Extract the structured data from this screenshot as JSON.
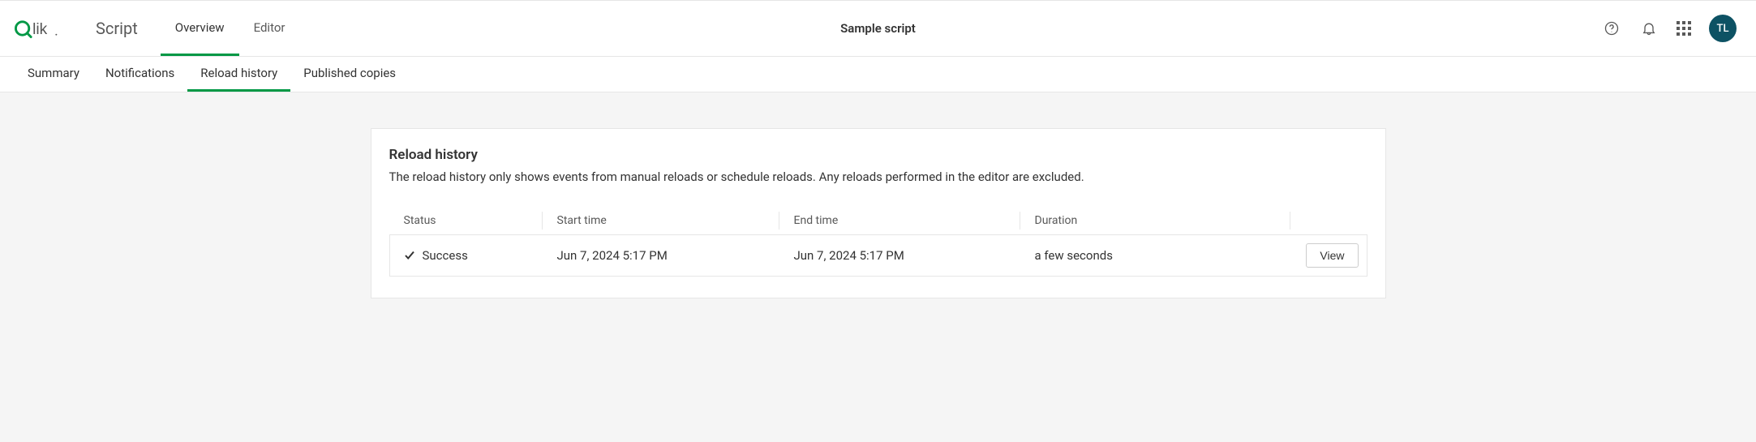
{
  "brand": {
    "name": "Qlik",
    "accent_green": "#009845",
    "accent_teal": "#0d5264"
  },
  "app_name": "Script",
  "top_tabs": [
    {
      "label": "Overview",
      "active": true
    },
    {
      "label": "Editor",
      "active": false
    }
  ],
  "page_title": "Sample script",
  "user_initials": "TL",
  "sub_tabs": [
    {
      "label": "Summary",
      "active": false
    },
    {
      "label": "Notifications",
      "active": false
    },
    {
      "label": "Reload history",
      "active": true
    },
    {
      "label": "Published copies",
      "active": false
    }
  ],
  "panel": {
    "title": "Reload history",
    "description": "The reload history only shows events from manual reloads or schedule reloads. Any reloads performed in the editor are excluded."
  },
  "table": {
    "columns": {
      "status": "Status",
      "start": "Start time",
      "end": "End time",
      "duration": "Duration"
    },
    "rows": [
      {
        "status": "Success",
        "start": "Jun 7, 2024 5:17 PM",
        "end": "Jun 7, 2024 5:17 PM",
        "duration": "a few seconds",
        "action": "View"
      }
    ]
  }
}
